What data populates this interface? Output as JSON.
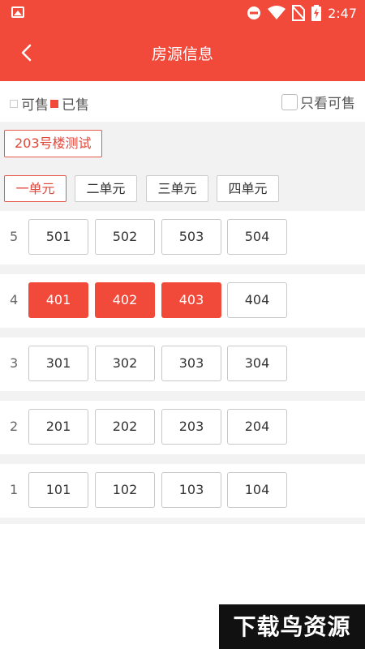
{
  "status_bar": {
    "time": "2:47",
    "icons": [
      "image-icon",
      "do-not-disturb-icon",
      "wifi-icon",
      "no-sim-icon",
      "battery-charging-icon"
    ]
  },
  "app_bar": {
    "title": "房源信息",
    "back_icon": "chevron-left-icon"
  },
  "legend": {
    "available_label": "可售",
    "sold_label": "已售",
    "only_available_label": "只看可售"
  },
  "building": {
    "name": "203号楼测试"
  },
  "unit_tabs": [
    {
      "label": "一单元",
      "active": true
    },
    {
      "label": "二单元",
      "active": false
    },
    {
      "label": "三单元",
      "active": false
    },
    {
      "label": "四单元",
      "active": false
    }
  ],
  "floors": [
    {
      "floor": "5",
      "rooms": [
        {
          "number": "501",
          "sold": false
        },
        {
          "number": "502",
          "sold": false
        },
        {
          "number": "503",
          "sold": false
        },
        {
          "number": "504",
          "sold": false
        }
      ]
    },
    {
      "floor": "4",
      "rooms": [
        {
          "number": "401",
          "sold": true
        },
        {
          "number": "402",
          "sold": true
        },
        {
          "number": "403",
          "sold": true
        },
        {
          "number": "404",
          "sold": false
        }
      ]
    },
    {
      "floor": "3",
      "rooms": [
        {
          "number": "301",
          "sold": false
        },
        {
          "number": "302",
          "sold": false
        },
        {
          "number": "303",
          "sold": false
        },
        {
          "number": "304",
          "sold": false
        }
      ]
    },
    {
      "floor": "2",
      "rooms": [
        {
          "number": "201",
          "sold": false
        },
        {
          "number": "202",
          "sold": false
        },
        {
          "number": "203",
          "sold": false
        },
        {
          "number": "204",
          "sold": false
        }
      ]
    },
    {
      "floor": "1",
      "rooms": [
        {
          "number": "101",
          "sold": false
        },
        {
          "number": "102",
          "sold": false
        },
        {
          "number": "103",
          "sold": false
        },
        {
          "number": "104",
          "sold": false
        }
      ]
    }
  ],
  "colors": {
    "accent": "#f24a3a",
    "background_gray": "#f2f2f2"
  },
  "watermark": {
    "text": "下载鸟资源"
  }
}
